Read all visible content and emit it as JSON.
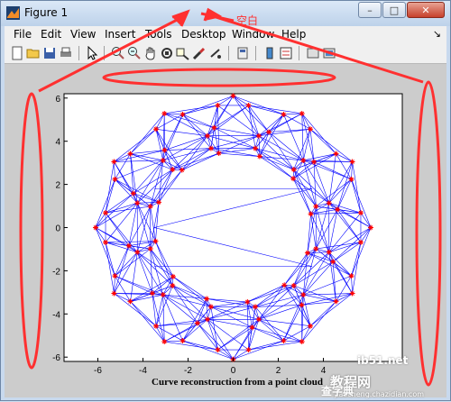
{
  "window": {
    "title": "Figure 1",
    "buttons": {
      "minimize": "–",
      "maximize": "□",
      "close": "✕"
    }
  },
  "menu": {
    "items": [
      "File",
      "Edit",
      "View",
      "Insert",
      "Tools",
      "Desktop",
      "Window",
      "Help"
    ],
    "extra": "↘"
  },
  "toolbar": {
    "icons": [
      "new-figure-icon",
      "open-icon",
      "save-icon",
      "print-icon",
      "select-arrow-icon",
      "zoom-in-icon",
      "zoom-out-icon",
      "pan-hand-icon",
      "rotate-3d-icon",
      "data-cursor-icon",
      "brush-icon",
      "link-plot-icon",
      "colorbar-icon",
      "legend-icon",
      "hide-plot-tools-icon",
      "show-plot-tools-icon"
    ]
  },
  "annotation": {
    "label": "空白",
    "color": "#ff3030"
  },
  "watermark": {
    "line1": "查字典",
    "line2": "教程网",
    "line3": "jiaocheng.chazidian.com",
    "site": "ib51.net"
  },
  "chart_data": {
    "type": "line",
    "title": "",
    "xlabel": "Curve reconstruction from a point cloud",
    "ylabel": "",
    "xlim": [
      -7.5,
      7.5
    ],
    "ylim": [
      -6.2,
      6.2
    ],
    "xticks": [
      -6,
      -4,
      -2,
      0,
      2,
      4
    ],
    "yticks": [
      -6,
      -4,
      -2,
      0,
      2,
      4,
      6
    ],
    "grid": false,
    "series": [
      {
        "kind": "mesh-lines",
        "color": "#0000ff"
      },
      {
        "kind": "points",
        "marker": "*",
        "color": "#ff0000"
      }
    ],
    "shape": {
      "lobes": 12,
      "outer_radius": 6.1,
      "inner_radius": 3.5
    }
  }
}
